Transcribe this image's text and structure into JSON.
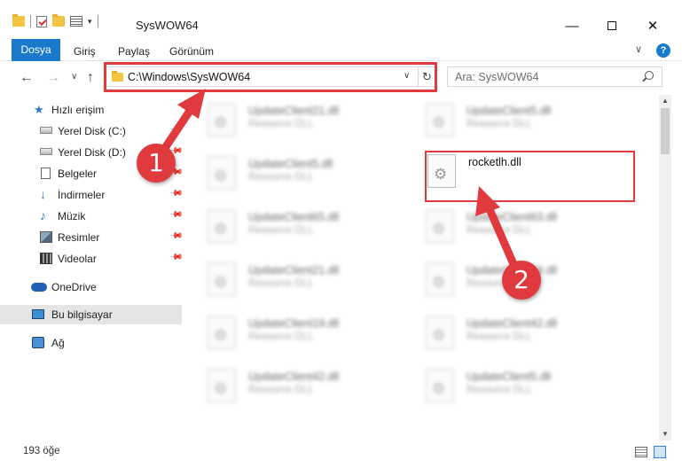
{
  "window": {
    "title": "SysWOW64",
    "minimize": "—",
    "close": "✕"
  },
  "ribbon": {
    "tabs": [
      "Dosya",
      "Giriş",
      "Paylaş",
      "Görünüm"
    ],
    "help": "?"
  },
  "address": {
    "path": "C:\\Windows\\SysWOW64",
    "search_placeholder": "Ara: SysWOW64"
  },
  "sidebar": {
    "items": [
      {
        "label": "Hızlı erişim",
        "icon": "star-icon",
        "pinned": false
      },
      {
        "label": "Yerel Disk (C:)",
        "icon": "drive-icon",
        "pinned": true
      },
      {
        "label": "Yerel Disk (D:)",
        "icon": "drive-icon",
        "pinned": true
      },
      {
        "label": "Belgeler",
        "icon": "documents-icon",
        "pinned": true
      },
      {
        "label": "İndirmeler",
        "icon": "download-icon",
        "pinned": true
      },
      {
        "label": "Müzik",
        "icon": "music-icon",
        "pinned": true
      },
      {
        "label": "Resimler",
        "icon": "pictures-icon",
        "pinned": true
      },
      {
        "label": "Videolar",
        "icon": "videos-icon",
        "pinned": true
      },
      {
        "label": "OneDrive",
        "icon": "onedrive-icon",
        "pinned": false
      },
      {
        "label": "Bu bilgisayar",
        "icon": "this-pc-icon",
        "pinned": false,
        "selected": true
      },
      {
        "label": "Ağ",
        "icon": "network-icon",
        "pinned": false
      }
    ]
  },
  "files": [
    {
      "name": "UpdateClient21.dll",
      "type": "Resource DLL"
    },
    {
      "name": "UpdateClient5.dll",
      "type": "Resource DLL"
    },
    {
      "name": "UpdateClient5.dll",
      "type": "Resource DLL"
    },
    {
      "name": "rocketlh.dll",
      "type": ""
    },
    {
      "name": "UpdateClient65.dll",
      "type": "Resource DLL"
    },
    {
      "name": "UpdateClient63.dll",
      "type": "Resource DLL"
    },
    {
      "name": "UpdateClient21.dll",
      "type": "Resource DLL"
    },
    {
      "name": "UpdateClient19.dll",
      "type": "Resource DLL"
    },
    {
      "name": "UpdateClient19.dll",
      "type": "Resource DLL"
    },
    {
      "name": "UpdateClient42.dll",
      "type": "Resource DLL"
    },
    {
      "name": "UpdateClient42.dll",
      "type": "Resource DLL"
    },
    {
      "name": "UpdateClient5.dll",
      "type": "Resource DLL"
    }
  ],
  "status": {
    "item_count": "193 öğe"
  },
  "annotations": {
    "step1": "1",
    "step2": "2",
    "color": "#e0393e"
  }
}
